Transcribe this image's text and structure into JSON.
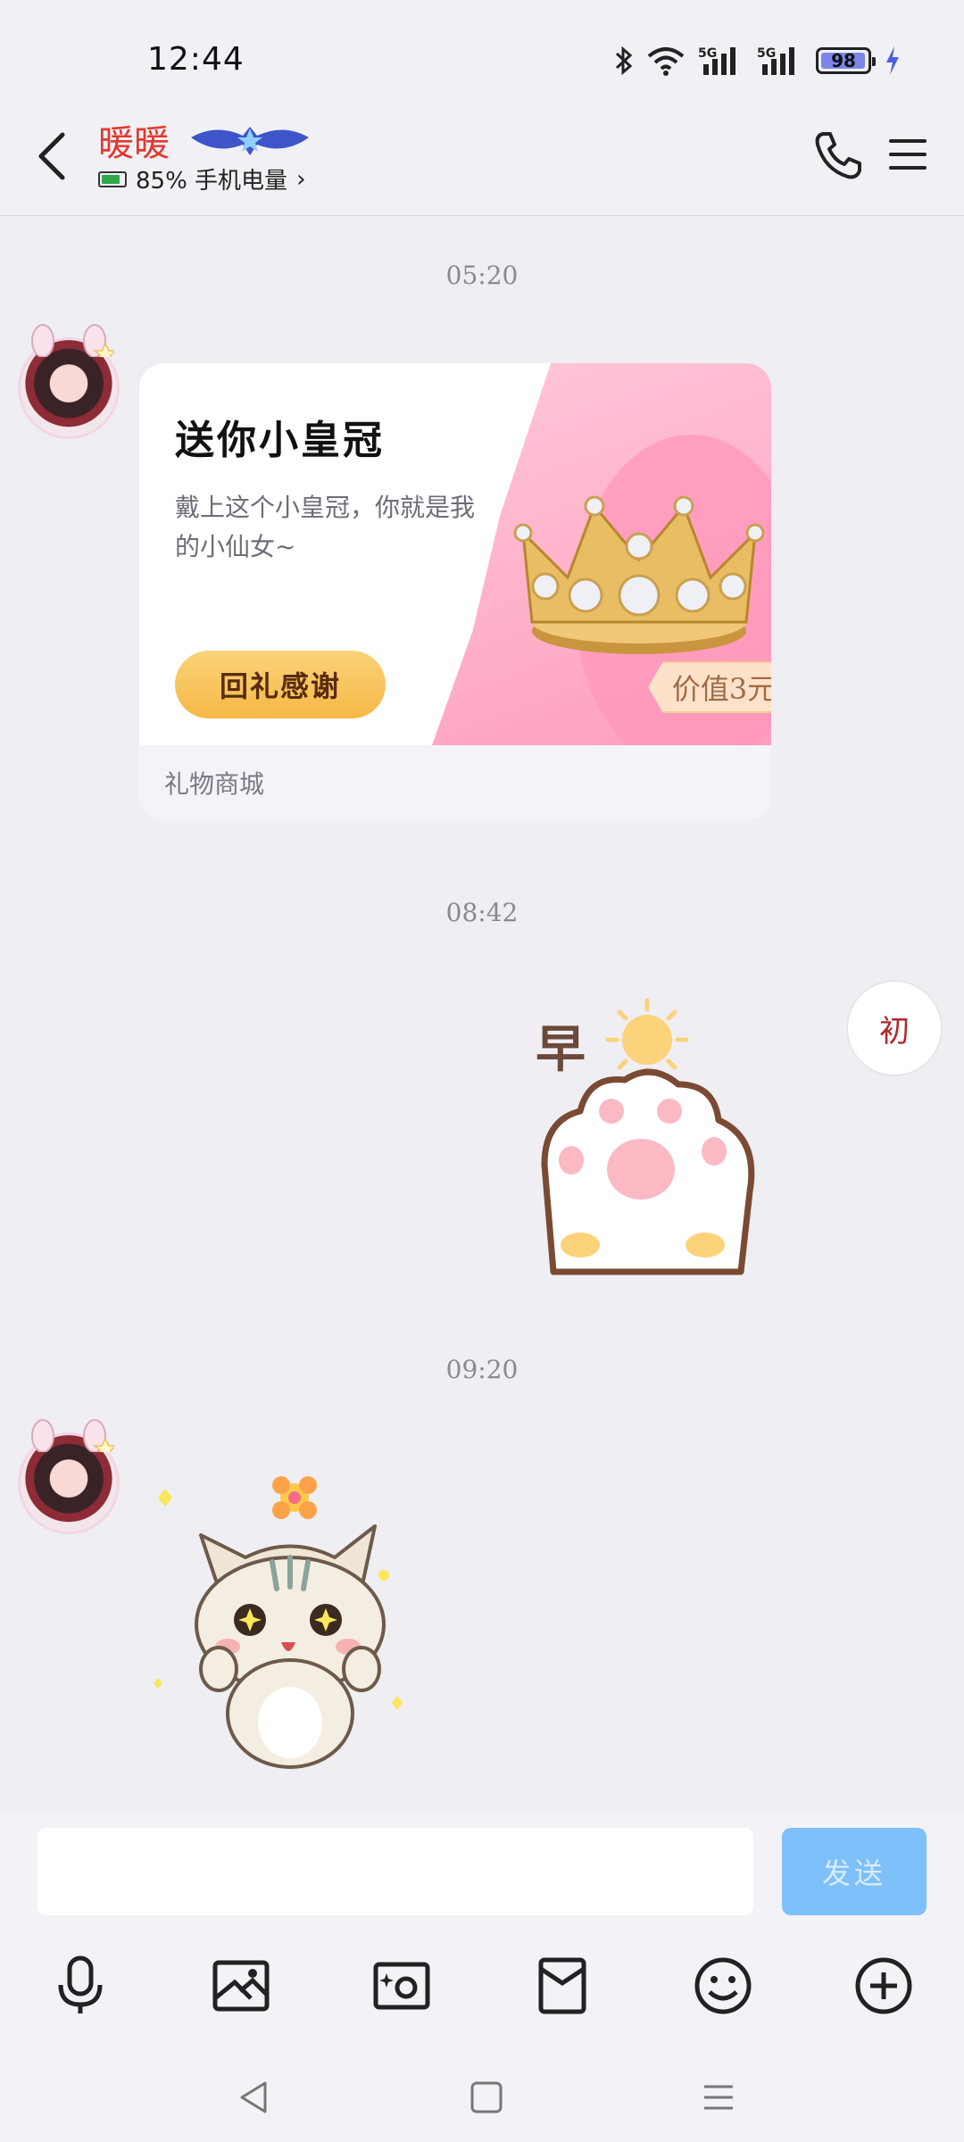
{
  "status_bar": {
    "time": "12:44",
    "network_1": "5G",
    "network_2": "5G",
    "battery_level": "98",
    "battery_fill": 0.98
  },
  "header": {
    "contact_name": "暖暖",
    "battery_share_text": "85% 手机电量",
    "battery_share_level": 0.85,
    "chevron": "›"
  },
  "messages": {
    "timestamp_1": "05:20",
    "timestamp_2": "08:42",
    "timestamp_3": "09:20",
    "gift_card": {
      "title": "送你小皇冠",
      "description": "戴上这个小皇冠，你就是我的小仙女~",
      "button_label": "回礼感谢",
      "price_label": "价值3元",
      "footer_label": "礼物商城"
    },
    "sticker_morning_text": "早",
    "my_avatar_text": "初"
  },
  "input_bar": {
    "input_value": "",
    "send_label": "发送"
  },
  "colors": {
    "accent": "#7ec0f9",
    "name": "#e0392f",
    "gift_button": "#f5b845"
  },
  "icons": {
    "back": "back-arrow-icon",
    "call": "phone-icon",
    "menu": "hamburger-menu-icon",
    "voice": "microphone-icon",
    "image": "image-icon",
    "camera": "camera-icon",
    "red_packet": "red-envelope-icon",
    "emoji": "emoji-icon",
    "more": "plus-circle-icon"
  }
}
